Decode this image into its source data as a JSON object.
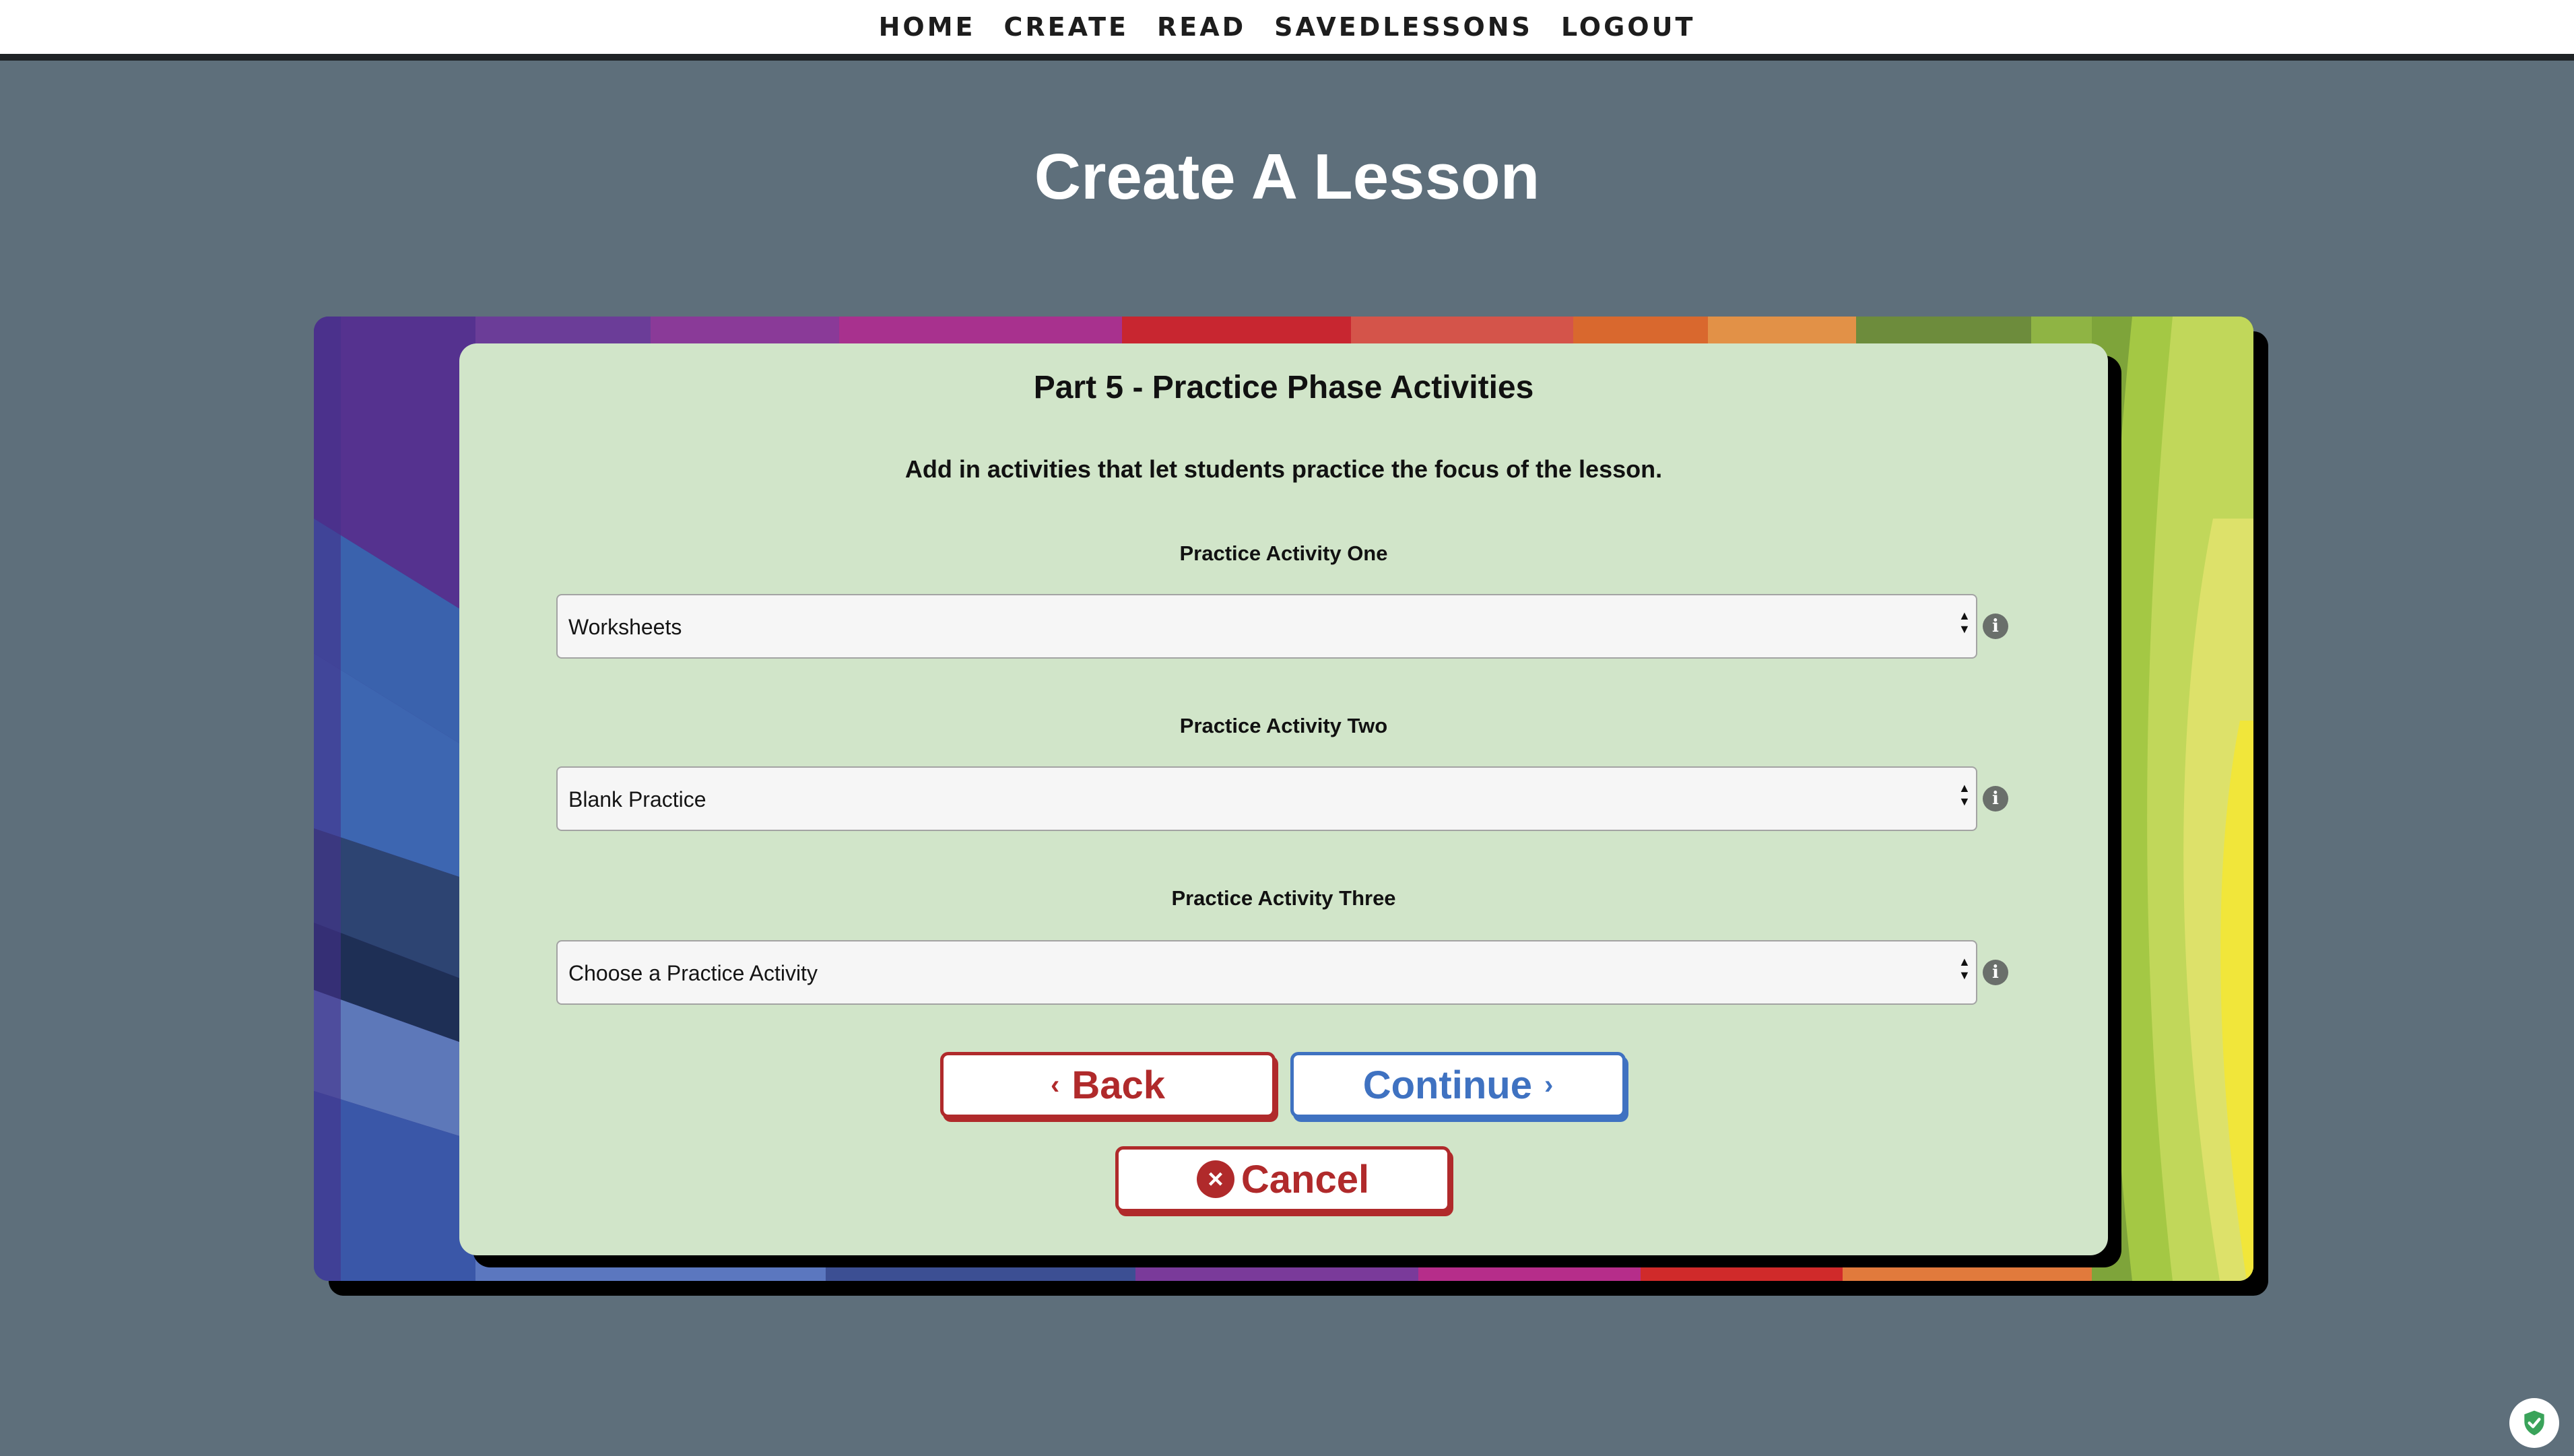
{
  "nav": {
    "items": [
      "HOME",
      "CREATE",
      "READ",
      "SAVEDLESSONS",
      "LOGOUT"
    ]
  },
  "page": {
    "title": "Create A Lesson"
  },
  "card": {
    "part_title": "Part 5 - Practice Phase Activities",
    "description": "Add in activities that let students practice the focus of the lesson.",
    "fields": [
      {
        "label": "Practice Activity One",
        "value": "Worksheets"
      },
      {
        "label": "Practice Activity Two",
        "value": "Blank Practice"
      },
      {
        "label": "Practice Activity Three",
        "value": "Choose a Practice Activity"
      }
    ],
    "info_icon": "i"
  },
  "buttons": {
    "back": "Back",
    "continue": "Continue",
    "cancel": "Cancel"
  },
  "icons": {
    "back": "chevron-left-icon",
    "continue": "chevron-right-icon",
    "cancel": "x-circle-icon",
    "info": "info-icon",
    "badge": "shield-check-icon"
  },
  "colors": {
    "background": "#5e6f7b",
    "card": "#d1e5c9",
    "danger": "#b02a2b",
    "primary": "#3f72c1"
  }
}
